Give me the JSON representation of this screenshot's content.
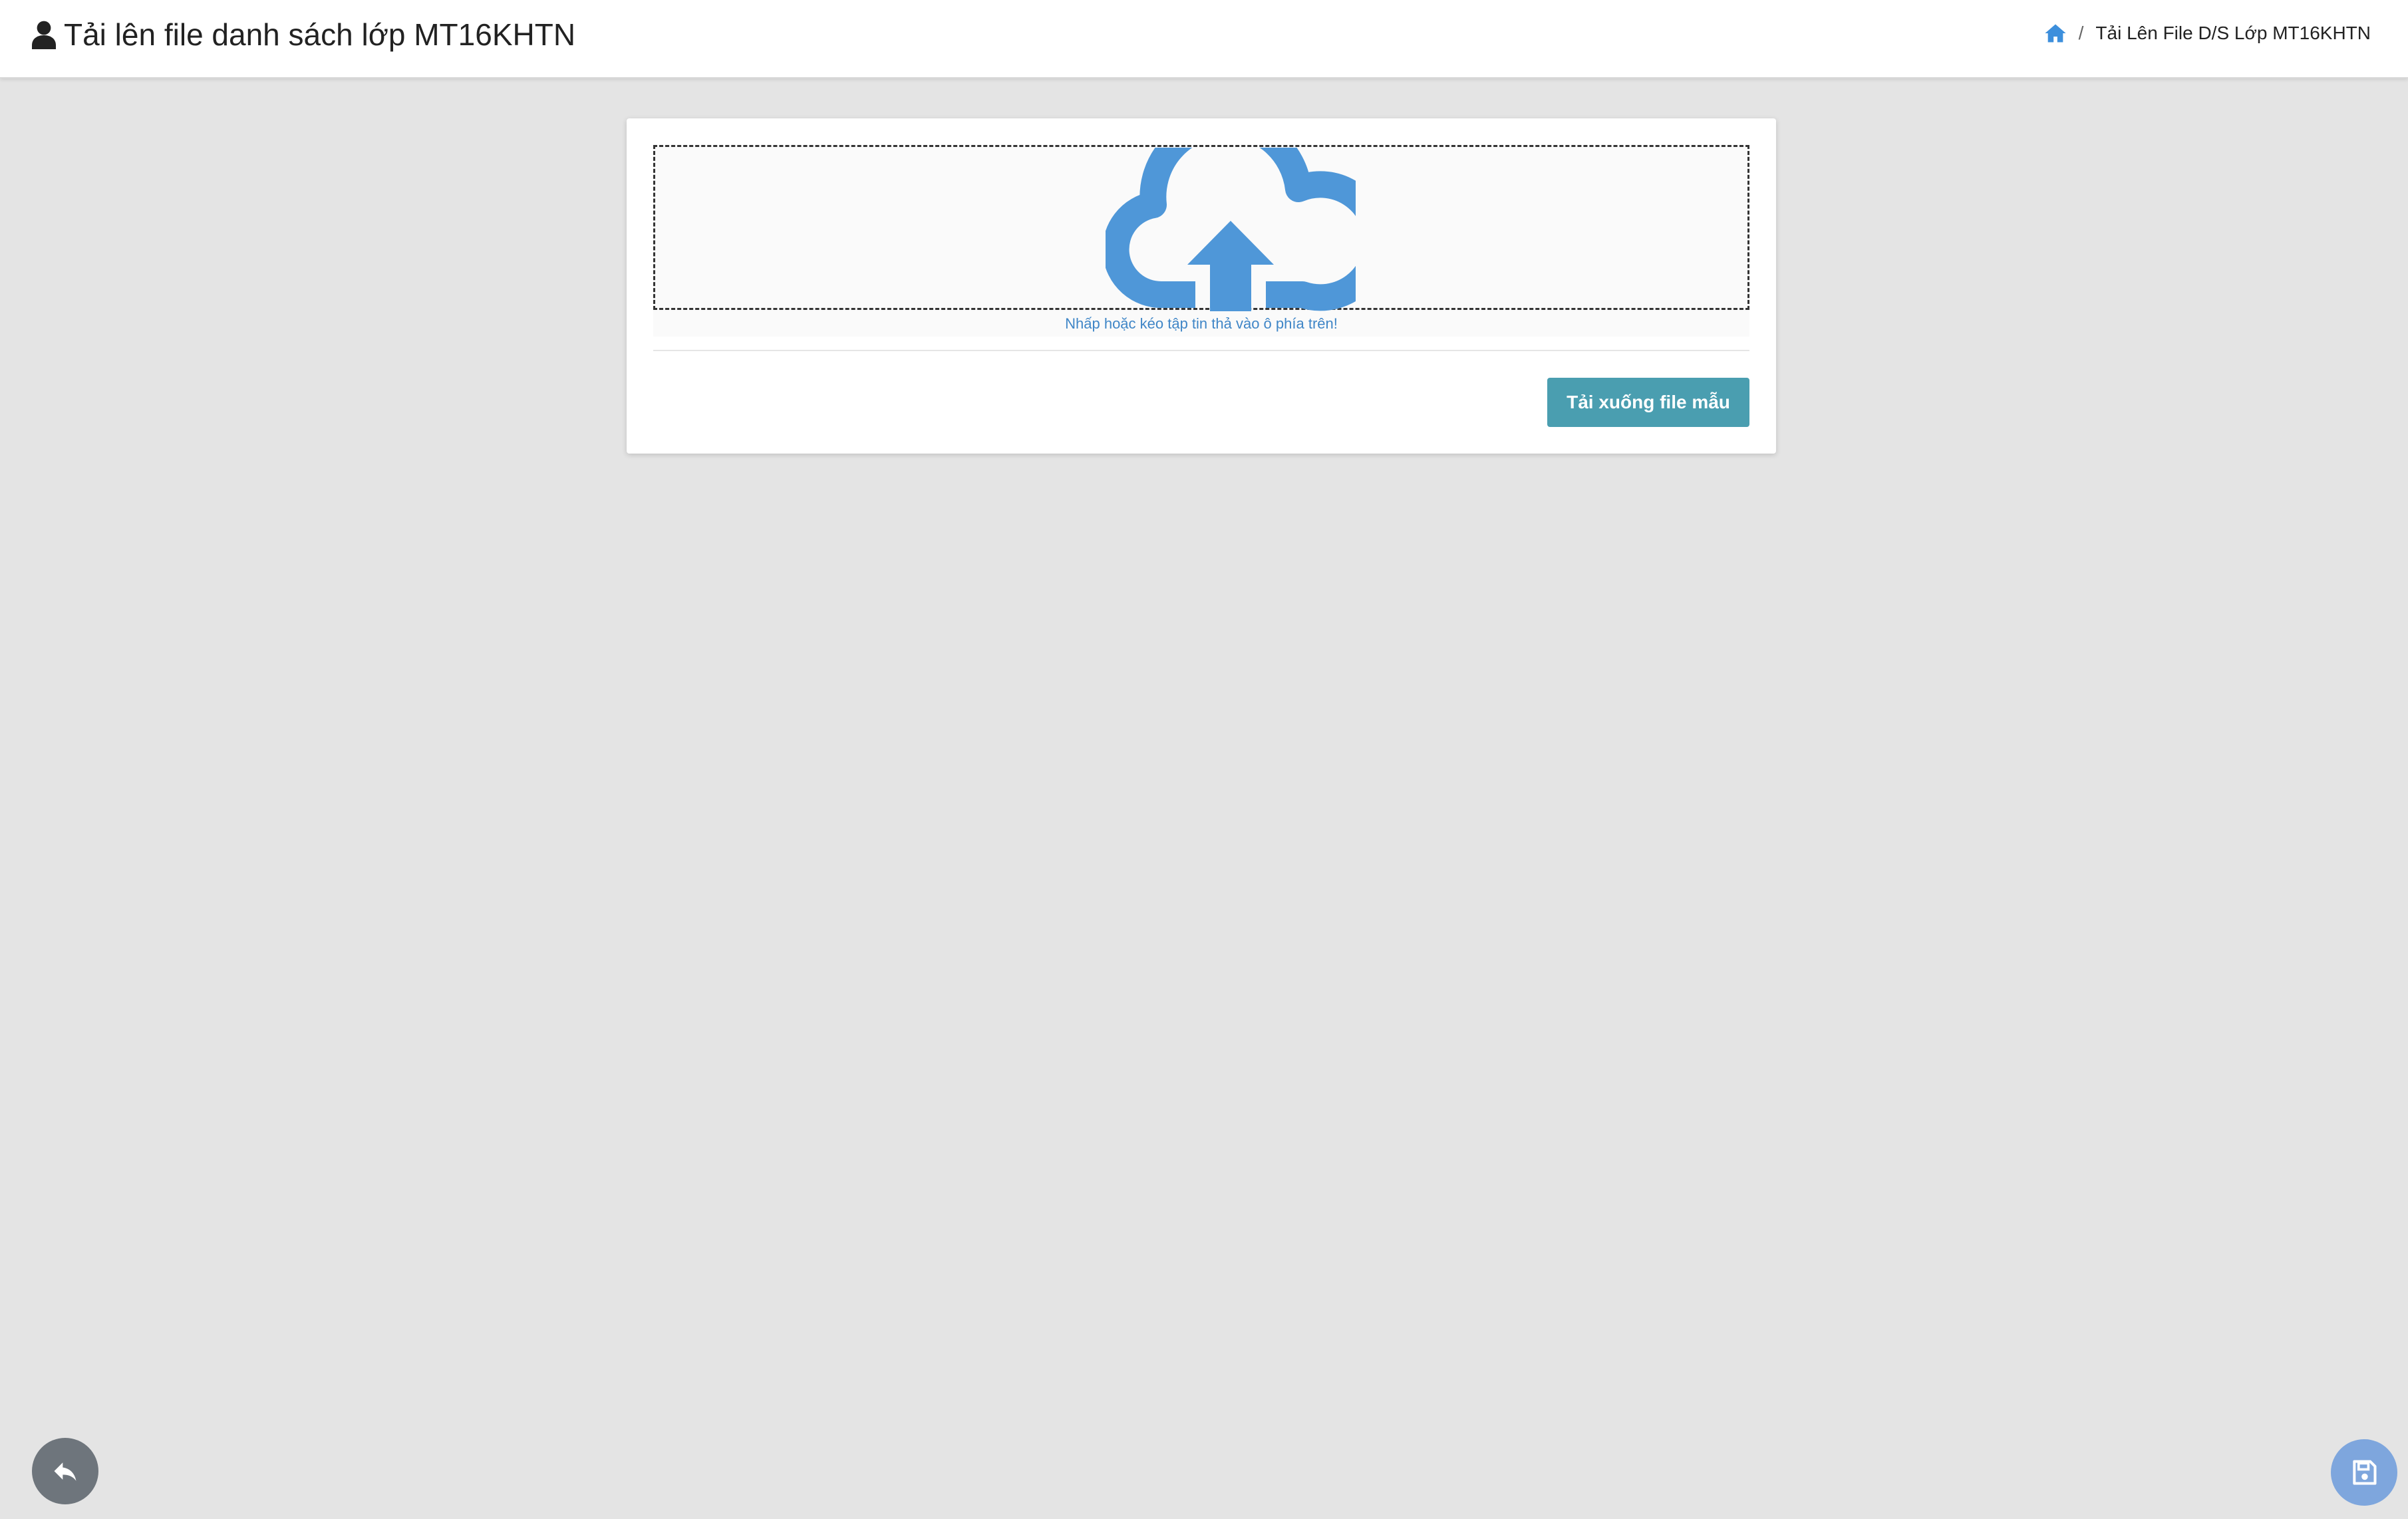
{
  "header": {
    "title": "Tải lên file danh sách lớp MT16KHTN",
    "title_icon": "user-icon",
    "breadcrumb": {
      "home_icon": "home-icon",
      "separator": "/",
      "current": "Tải Lên File D/S Lớp MT16KHTN"
    }
  },
  "upload": {
    "icon": "cloud-upload-icon",
    "hint": "Nhấp hoặc kéo tập tin thả vào ô phía trên!"
  },
  "actions": {
    "download_template_label": "Tải xuống file mẫu"
  },
  "fab": {
    "back_icon": "reply-icon",
    "save_icon": "floppy-disk-icon"
  },
  "colors": {
    "accent": "#4a9eb0",
    "cloud": "#4f97d8",
    "link": "#3f86c7",
    "background": "#e4e4e4"
  }
}
